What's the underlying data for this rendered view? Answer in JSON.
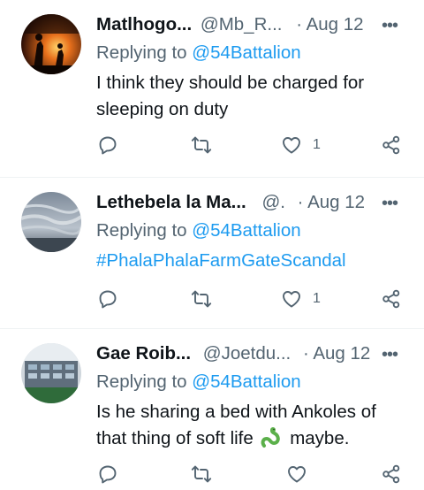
{
  "tweets": [
    {
      "name": "Matlhogo...",
      "handle": "@Mb_R...",
      "date": "Aug 12",
      "replying_prefix": "Replying to ",
      "replying_to": "@54Battalion",
      "text_line1": "I think they should be charged for",
      "text_line2": "sleeping on duty",
      "like_count": "1",
      "avatar_icon": "night-fire-avatar"
    },
    {
      "name": "Lethebela la Ma...",
      "handle": "@.",
      "date": "Aug 12",
      "replying_prefix": "Replying to ",
      "replying_to": "@54Battalion",
      "hashtag": "#PhalaPhalaFarmGateScandal",
      "like_count": "1",
      "avatar_icon": "cloudy-sky-avatar"
    },
    {
      "name": "Gae Roib...",
      "handle": "@Joetdu...",
      "date": "Aug 12",
      "replying_prefix": "Replying to ",
      "replying_to": "@54Battalion",
      "text_line1": "Is he sharing a bed with Ankoles of",
      "text_line2_a": "that thing of soft life",
      "text_line2_b": "maybe.",
      "emoji_icon": "green-snake-emoji",
      "avatar_icon": "building-avatar"
    }
  ],
  "separator": "·",
  "more_label": "•••",
  "colors": {
    "link": "#1d9bf0",
    "muted": "#536471",
    "text": "#0f1419",
    "divider": "#eff3f4"
  }
}
